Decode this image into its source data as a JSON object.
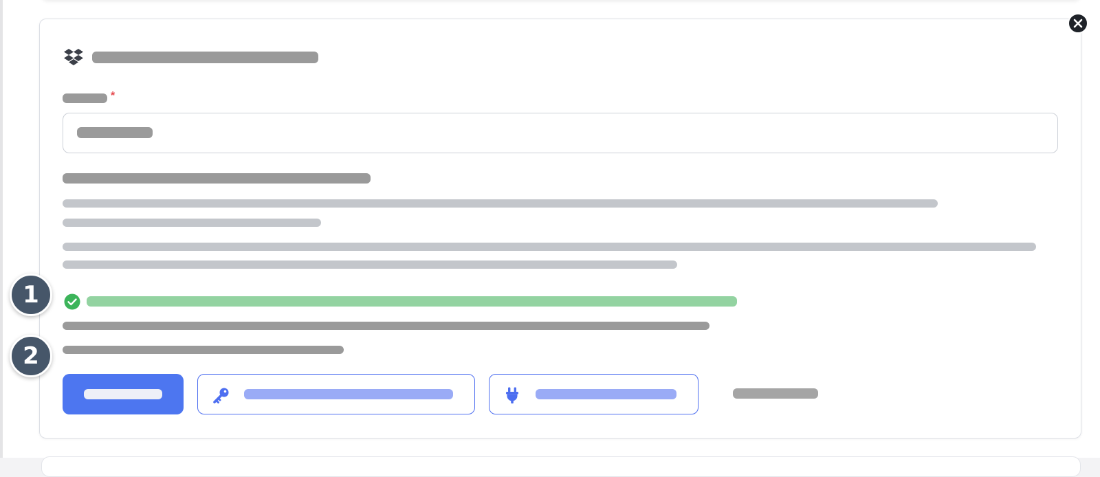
{
  "header": {
    "title": "",
    "icon": "dropbox-icon"
  },
  "field": {
    "label": "",
    "required_marker": "*",
    "value": ""
  },
  "section": {
    "heading": "",
    "paragraph_1": [
      "",
      ""
    ],
    "paragraph_2": [
      "",
      ""
    ]
  },
  "status": {
    "success_text": "",
    "line_1": "",
    "line_2": "",
    "success_color": "#3cb45a"
  },
  "steps": [
    "1",
    "2"
  ],
  "actions": {
    "primary_label": "",
    "key_button_label": "",
    "plug_button_label": "",
    "link_label": "",
    "accent_color": "#4d76f0"
  },
  "close_icon": "close-icon"
}
